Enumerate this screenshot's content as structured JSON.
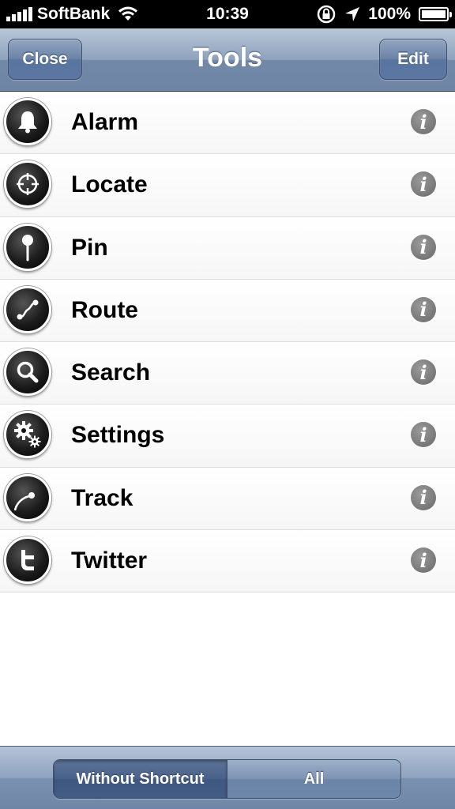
{
  "status_bar": {
    "carrier": "SoftBank",
    "time": "10:39",
    "battery": "100%"
  },
  "nav": {
    "title": "Tools",
    "close_label": "Close",
    "edit_label": "Edit"
  },
  "tools": [
    {
      "label": "Alarm",
      "icon": "bell-icon"
    },
    {
      "label": "Locate",
      "icon": "crosshair-icon"
    },
    {
      "label": "Pin",
      "icon": "pin-icon"
    },
    {
      "label": "Route",
      "icon": "route-icon"
    },
    {
      "label": "Search",
      "icon": "magnifier-icon"
    },
    {
      "label": "Settings",
      "icon": "gears-icon"
    },
    {
      "label": "Track",
      "icon": "track-icon"
    },
    {
      "label": "Twitter",
      "icon": "twitter-icon"
    }
  ],
  "info_glyph": "i",
  "toolbar": {
    "segments": [
      "Without Shortcut",
      "All"
    ],
    "selected": "Without Shortcut"
  },
  "colors": {
    "nav_blue": "#7389a8",
    "icon_black": "#1c1c1c",
    "info_gray": "#777777"
  }
}
